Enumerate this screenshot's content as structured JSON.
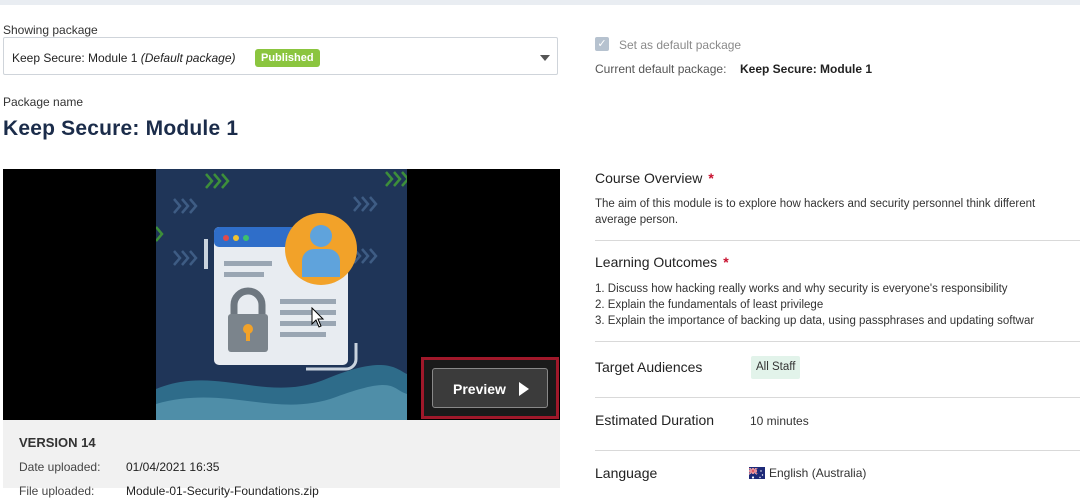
{
  "package_selector": {
    "label": "Showing package",
    "selected_name": "Keep Secure: Module 1",
    "selected_suffix": "(Default package)",
    "status_badge": "Published"
  },
  "default_settings": {
    "checkbox_label": "Set as default package",
    "checked": true,
    "current_label": "Current default package:",
    "current_value": "Keep Secure: Module 1"
  },
  "package": {
    "name_label": "Package name",
    "name": "Keep Secure: Module 1"
  },
  "media": {
    "preview_label": "Preview"
  },
  "version": {
    "title": "VERSION 14",
    "rows": [
      {
        "label": "Date uploaded:",
        "value": "01/04/2021 16:35"
      },
      {
        "label": "File uploaded:",
        "value": "Module-01-Security-Foundations.zip"
      }
    ]
  },
  "details": {
    "overview_title": "Course Overview",
    "overview_text": "The aim of this module is to explore how hackers and security personnel think different",
    "overview_text_2": "average person.",
    "outcomes_title": "Learning Outcomes",
    "outcomes": [
      "1. Discuss how hacking really works and why security is everyone's responsibility",
      "2. Explain the fundamentals of least privilege",
      "3. Explain the importance of backing up data, using passphrases and updating softwar"
    ],
    "audiences_title": "Target Audiences",
    "audience_tag": "All Staff",
    "duration_title": "Estimated Duration",
    "duration_value": "10 minutes",
    "language_title": "Language",
    "language_value": "English (Australia)"
  },
  "colors": {
    "brand_navy": "#1b2c4a",
    "published_green": "#8bc53f",
    "required_red": "#c8102e",
    "highlight_border": "#a0182a"
  }
}
